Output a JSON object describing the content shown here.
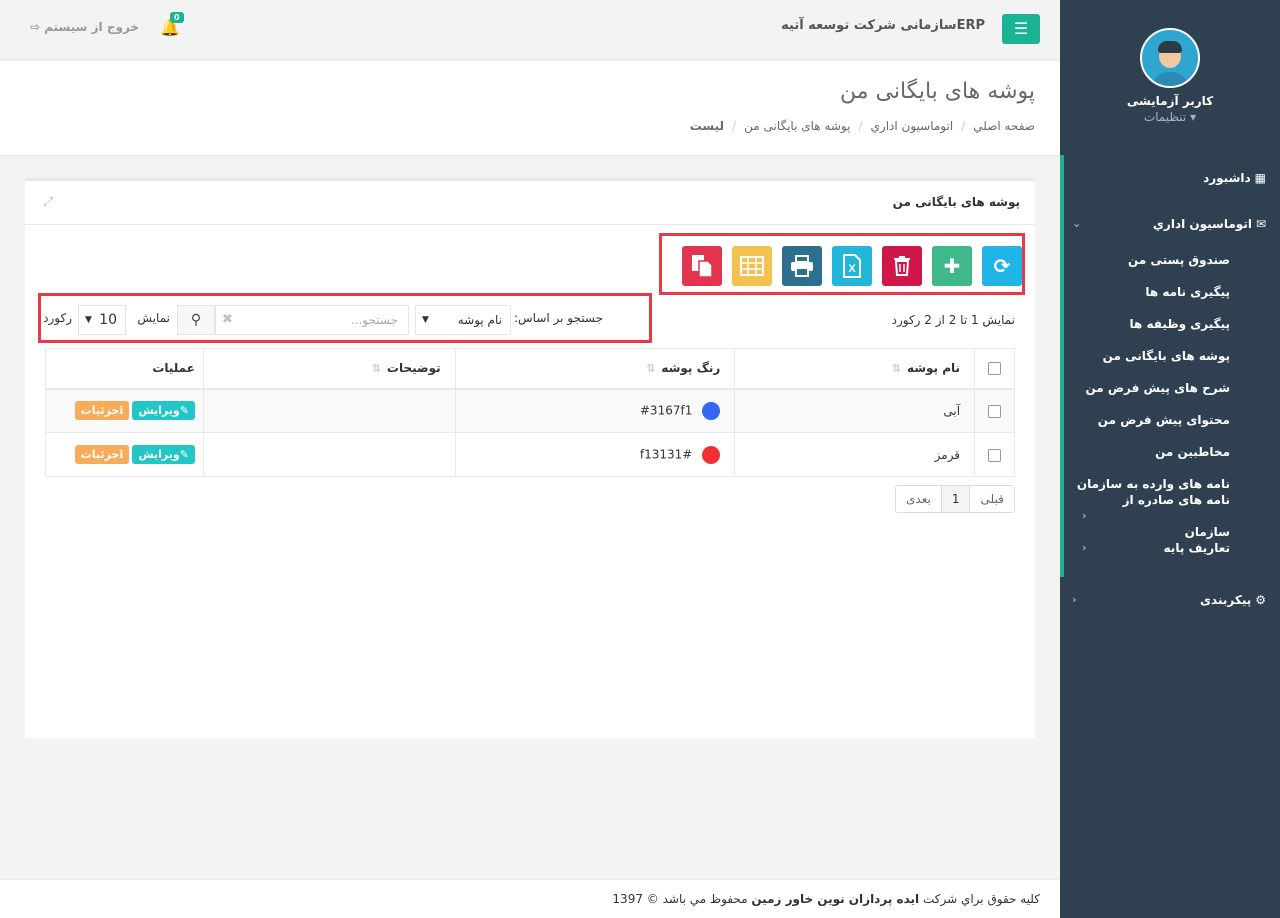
{
  "topbar": {
    "menu_toggle_icon": "bars-icon",
    "brand": "ERPسازمانی شرکت توسعه آتیه",
    "notification_count": "0",
    "logout_label": "خروج از سیستم"
  },
  "sidebar": {
    "user_name": "کاربر آزمایشی",
    "settings_label": "تنظیمات",
    "dashboard": "داشبورد",
    "office_automation": "اتوماسیون اداري",
    "items": [
      {
        "label": "صندوق پستی من"
      },
      {
        "label": "پیگیری نامه ها"
      },
      {
        "label": "پیگیری وظیفه ها"
      },
      {
        "label": "پوشه های بایگانی من"
      },
      {
        "label": "شرح های پیش فرض من"
      },
      {
        "label": "محتوای پیش فرض من"
      },
      {
        "label": "مخاطبین من"
      },
      {
        "label": "نامه های وارده به سازمان"
      },
      {
        "label": "نامه های صادره از سازمان"
      },
      {
        "label": "تعاریف پایه"
      }
    ],
    "config": "پیکربندی",
    "accent_color": "#1ab394"
  },
  "page": {
    "title": "پوشه های بایگانی من",
    "breadcrumb": [
      "صفحه اصلي",
      "اتوماسیون اداري",
      "پوشه های بایگانی من",
      "لیست"
    ]
  },
  "panel": {
    "title": "پوشه های بایگانی من",
    "toolbar": [
      {
        "name": "refresh",
        "color": "#1fb5e6"
      },
      {
        "name": "add",
        "color": "#3fb88a"
      },
      {
        "name": "delete",
        "color": "#d0174a"
      },
      {
        "name": "excel",
        "color": "#22b6d8"
      },
      {
        "name": "print",
        "color": "#2c6f8f"
      },
      {
        "name": "columns",
        "color": "#f2c14e"
      },
      {
        "name": "copy",
        "color": "#e2344e"
      }
    ],
    "filter": {
      "search_by_label": "جستجو بر اساس:",
      "search_field": "نام پوشه",
      "search_placeholder": "جستجو...",
      "show_label": "نمایش",
      "page_size": "10",
      "records_label": "رکورد"
    },
    "info": "نمایش 1 تا 2 از 2 رکورد",
    "columns": {
      "name": "نام پوشه",
      "color": "رنگ پوشه",
      "desc": "توضیحات",
      "actions": "عملیات"
    },
    "rows": [
      {
        "name": "آبی",
        "color_text": "#3167f1",
        "color": "#3167f1",
        "desc": "",
        "edit": "ویرایش",
        "details": "جزئیات"
      },
      {
        "name": "قرمز",
        "color_text": "f13131#",
        "color": "#f13131",
        "desc": "",
        "edit": "ویرایش",
        "details": "جزئیات"
      }
    ],
    "pager": {
      "prev": "قبلی",
      "current": "1",
      "next": "بعدی"
    }
  },
  "footer": {
    "prefix": "کلیه حقوق براي شرکت",
    "company": "ایده پردازان نوین خاور زمین",
    "suffix": "محفوظ مي باشد © 1397"
  }
}
